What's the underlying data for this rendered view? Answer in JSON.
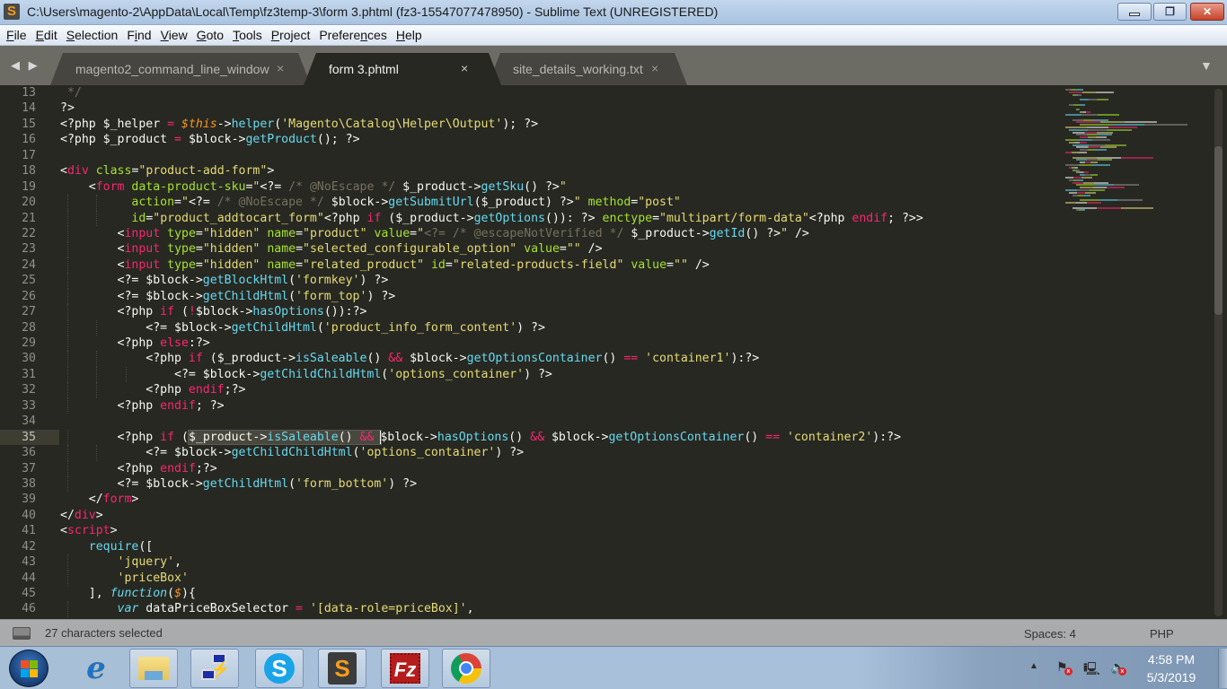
{
  "window": {
    "title": "C:\\Users\\magento-2\\AppData\\Local\\Temp\\fz3temp-3\\form 3.phtml (fz3-15547077478950) - Sublime Text (UNREGISTERED)",
    "app_icon": "sublime-text-icon",
    "controls": {
      "minimize": "minimize",
      "maximize": "restore",
      "close": "close"
    }
  },
  "menu": {
    "items": [
      {
        "label": "File",
        "mnemonic": "F"
      },
      {
        "label": "Edit",
        "mnemonic": "E"
      },
      {
        "label": "Selection",
        "mnemonic": "S"
      },
      {
        "label": "Find",
        "mnemonic": "i"
      },
      {
        "label": "View",
        "mnemonic": "V"
      },
      {
        "label": "Goto",
        "mnemonic": "G"
      },
      {
        "label": "Tools",
        "mnemonic": "T"
      },
      {
        "label": "Project",
        "mnemonic": "P"
      },
      {
        "label": "Preferences",
        "mnemonic": "n"
      },
      {
        "label": "Help",
        "mnemonic": "H"
      }
    ]
  },
  "tabs": {
    "nav": "◀ ▶",
    "items": [
      {
        "label": "magento2_command_line_window",
        "close": "×",
        "active": false
      },
      {
        "label": "form 3.phtml",
        "close": "×",
        "active": true
      },
      {
        "label": "site_details_working.txt",
        "close": "×",
        "active": false
      }
    ],
    "dropdown": "▼"
  },
  "editor": {
    "current_line": 35,
    "lines": [
      {
        "n": "13",
        "html": "<span class=\"c\"> */</span>"
      },
      {
        "n": "14",
        "html": "?>"
      },
      {
        "n": "15",
        "html": "&lt;?php $_helper <span class=\"t\">=</span> <span class=\"v\">$this</span>-><span class=\"f\">helper</span>(<span class=\"s\">'Magento\\Catalog\\Helper\\Output'</span>); ?>"
      },
      {
        "n": "16",
        "html": "&lt;?php $_product <span class=\"t\">=</span> $block-><span class=\"f\">getProduct</span>(); ?>"
      },
      {
        "n": "17",
        "html": ""
      },
      {
        "n": "18",
        "html": "&lt;<span class=\"t\">div</span> <span class=\"a\">class</span>=<span class=\"s\">\"product-add-form\"</span>>"
      },
      {
        "n": "19",
        "html": "    &lt;<span class=\"t\">form</span> <span class=\"a\">data-product-sku</span>=<span class=\"s\">\"</span>&lt;?= <span class=\"c\">/* @NoEscape */</span> $_product-><span class=\"f\">getSku</span>() ?><span class=\"s\">\"</span>"
      },
      {
        "n": "20",
        "html": "          <span class=\"a\">action</span>=<span class=\"s\">\"</span>&lt;?= <span class=\"c\">/* @NoEscape */</span> $block-><span class=\"f\">getSubmitUrl</span>($_product) ?><span class=\"s\">\"</span> <span class=\"a\">method</span>=<span class=\"s\">\"post\"</span>"
      },
      {
        "n": "21",
        "html": "          <span class=\"a\">id</span>=<span class=\"s\">\"product_addtocart_form\"</span>&lt;?php <span class=\"t\">if</span> ($_product-><span class=\"f\">getOptions</span>()): ?> <span class=\"a\">enctype</span>=<span class=\"s\">\"multipart/form-data\"</span>&lt;?php <span class=\"t\">endif</span>; ?>>"
      },
      {
        "n": "22",
        "html": "        &lt;<span class=\"t\">input</span> <span class=\"a\">type</span>=<span class=\"s\">\"hidden\"</span> <span class=\"a\">name</span>=<span class=\"s\">\"product\"</span> <span class=\"a\">value</span>=<span class=\"s\">\"</span><span class=\"c\">&lt;?= /* @escapeNotVerified */</span> $_product-><span class=\"f\">getId</span>() ?><span class=\"s\">\"</span> />"
      },
      {
        "n": "23",
        "html": "        &lt;<span class=\"t\">input</span> <span class=\"a\">type</span>=<span class=\"s\">\"hidden\"</span> <span class=\"a\">name</span>=<span class=\"s\">\"selected_configurable_option\"</span> <span class=\"a\">value</span>=<span class=\"s\">\"\"</span> />"
      },
      {
        "n": "24",
        "html": "        &lt;<span class=\"t\">input</span> <span class=\"a\">type</span>=<span class=\"s\">\"hidden\"</span> <span class=\"a\">name</span>=<span class=\"s\">\"related_product\"</span> <span class=\"a\">id</span>=<span class=\"s\">\"related-products-field\"</span> <span class=\"a\">value</span>=<span class=\"s\">\"\"</span> />"
      },
      {
        "n": "25",
        "html": "        &lt;?= $block-><span class=\"f\">getBlockHtml</span>(<span class=\"s\">'formkey'</span>) ?>"
      },
      {
        "n": "26",
        "html": "        &lt;?= $block-><span class=\"f\">getChildHtml</span>(<span class=\"s\">'form_top'</span>) ?>"
      },
      {
        "n": "27",
        "html": "        &lt;?php <span class=\"t\">if</span> (<span class=\"t\">!</span>$block-><span class=\"f\">hasOptions</span>()):?>"
      },
      {
        "n": "28",
        "html": "            &lt;?= $block-><span class=\"f\">getChildHtml</span>(<span class=\"s\">'product_info_form_content'</span>) ?>"
      },
      {
        "n": "29",
        "html": "        &lt;?php <span class=\"t\">else</span>:?>"
      },
      {
        "n": "30",
        "html": "            &lt;?php <span class=\"t\">if</span> ($_product-><span class=\"f\">isSaleable</span>() <span class=\"t\">&amp;&amp;</span> $block-><span class=\"f\">getOptionsContainer</span>() <span class=\"t\">==</span> <span class=\"s\">'container1'</span>):?>"
      },
      {
        "n": "31",
        "html": "                &lt;?= $block-><span class=\"f\">getChildChildHtml</span>(<span class=\"s\">'options_container'</span>) ?>"
      },
      {
        "n": "32",
        "html": "            &lt;?php <span class=\"t\">endif</span>;?>"
      },
      {
        "n": "33",
        "html": "        &lt;?php <span class=\"t\">endif</span>; ?>"
      },
      {
        "n": "34",
        "html": ""
      },
      {
        "n": "35",
        "html": "        &lt;?php <span class=\"t\">if</span> (<span class=\"sel\">$_product-><span class=\"f\">isSaleable</span>() <span class=\"t\">&amp;&amp;</span> </span><span class=\"cursor\"></span>$block-><span class=\"f\">hasOptions</span>() <span class=\"t\">&amp;&amp;</span> $block-><span class=\"f\">getOptionsContainer</span>() <span class=\"t\">==</span> <span class=\"s\">'container2'</span>):?>"
      },
      {
        "n": "36",
        "html": "            &lt;?= $block-><span class=\"f\">getChildChildHtml</span>(<span class=\"s\">'options_container'</span>) ?>"
      },
      {
        "n": "37",
        "html": "        &lt;?php <span class=\"t\">endif</span>;?>"
      },
      {
        "n": "38",
        "html": "        &lt;?= $block-><span class=\"f\">getChildHtml</span>(<span class=\"s\">'form_bottom'</span>) ?>"
      },
      {
        "n": "39",
        "html": "    &lt;/<span class=\"t\">form</span>>"
      },
      {
        "n": "40",
        "html": "&lt;/<span class=\"t\">div</span>>"
      },
      {
        "n": "41",
        "html": "&lt;<span class=\"t\">script</span>>"
      },
      {
        "n": "42",
        "html": "    <span class=\"f\">require</span>(["
      },
      {
        "n": "43",
        "html": "        <span class=\"s\">'jquery'</span>,"
      },
      {
        "n": "44",
        "html": "        <span class=\"s\">'priceBox'</span>"
      },
      {
        "n": "45",
        "html": "    ], <span class=\"i\">function</span>(<span class=\"v\">$</span>){"
      },
      {
        "n": "46",
        "html": "        <span class=\"i\">var</span> dataPriceBoxSelector <span class=\"t\">=</span> <span class=\"s\">'[data-role=priceBox]'</span>,"
      }
    ]
  },
  "statusbar": {
    "selection": "27 characters selected",
    "indentation": "Spaces: 4",
    "syntax": "PHP"
  },
  "taskbar": {
    "pinned": [
      {
        "name": "internet-explorer"
      },
      {
        "name": "file-explorer"
      },
      {
        "name": "putty"
      },
      {
        "name": "skype"
      },
      {
        "name": "sublime-text"
      },
      {
        "name": "filezilla"
      },
      {
        "name": "chrome"
      }
    ],
    "tray": {
      "overflow": "▲",
      "icons": [
        "action-center-flag",
        "network",
        "volume"
      ]
    },
    "clock": {
      "time": "4:58 PM",
      "date": "5/3/2019"
    }
  }
}
